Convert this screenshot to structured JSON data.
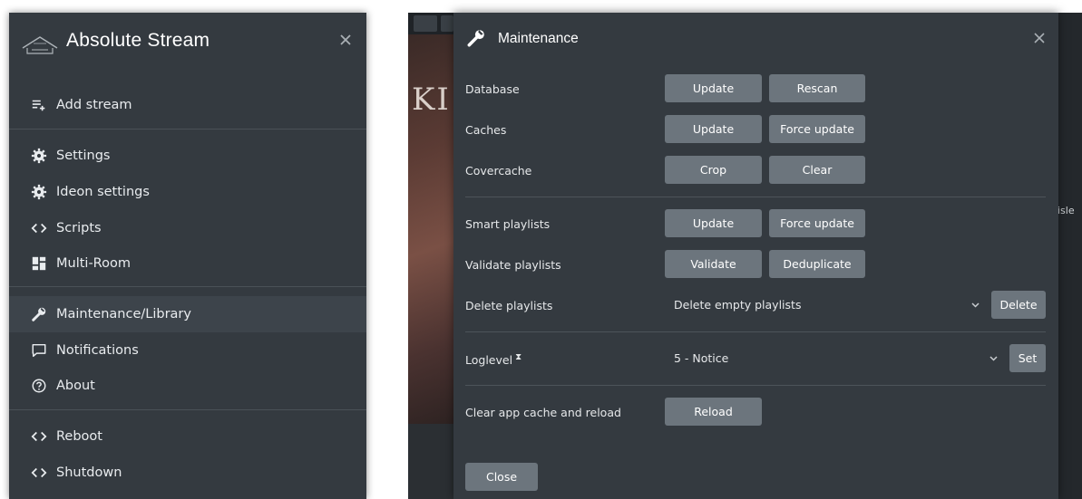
{
  "sidebar": {
    "title": "Absolute Stream",
    "close_icon": "close-icon",
    "items": [
      {
        "label": "Add stream",
        "icon": "playlist-add-icon"
      },
      {
        "label": "Settings",
        "icon": "gear-icon"
      },
      {
        "label": "Ideon settings",
        "icon": "gear-icon"
      },
      {
        "label": "Scripts",
        "icon": "code-icon"
      },
      {
        "label": "Multi-Room",
        "icon": "dashboard-icon"
      },
      {
        "label": "Maintenance/Library",
        "icon": "wrench-icon",
        "active": true
      },
      {
        "label": "Notifications",
        "icon": "message-icon"
      },
      {
        "label": "About",
        "icon": "help-circle-icon"
      },
      {
        "label": "Reboot",
        "icon": "code-icon"
      },
      {
        "label": "Shutdown",
        "icon": "code-icon"
      }
    ]
  },
  "background": {
    "art_letters": "KI",
    "side_text": "isle"
  },
  "modal": {
    "title": "Maintenance",
    "rows": {
      "database": {
        "label": "Database",
        "btn1": "Update",
        "btn2": "Rescan"
      },
      "caches": {
        "label": "Caches",
        "btn1": "Update",
        "btn2": "Force update"
      },
      "covercache": {
        "label": "Covercache",
        "btn1": "Crop",
        "btn2": "Clear"
      },
      "smart_playlists": {
        "label": "Smart playlists",
        "btn1": "Update",
        "btn2": "Force update"
      },
      "validate_playlists": {
        "label": "Validate playlists",
        "btn1": "Validate",
        "btn2": "Deduplicate"
      },
      "delete_playlists": {
        "label": "Delete playlists",
        "select_value": "Delete empty playlists",
        "btn": "Delete"
      },
      "loglevel": {
        "label": "Loglevel",
        "select_value": "5 - Notice",
        "btn": "Set"
      },
      "clear_cache": {
        "label": "Clear app cache and reload",
        "btn": "Reload"
      }
    },
    "close_label": "Close"
  },
  "colors": {
    "panel": "#343a40",
    "button": "#6c757d",
    "active_item": "#3d444b"
  }
}
